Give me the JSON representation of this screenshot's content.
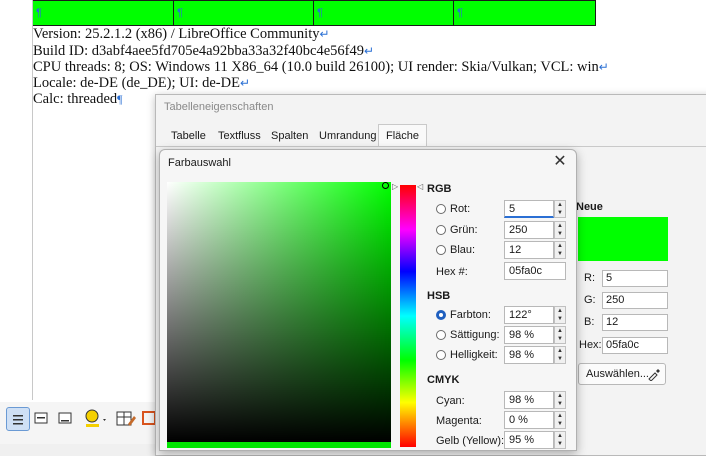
{
  "document": {
    "pilcrow": "¶",
    "line_break": "↵",
    "lines": {
      "version": "Version: 25.2.1.2 (x86) / LibreOffice Community",
      "build": "Build ID: d3abf4aee5fd705e4a92bba33a32f40bc4e56f49",
      "cpu": "CPU threads: 8; OS: Windows 11 X86_64 (10.0 build 26100); UI render: Skia/Vulkan; VCL: win",
      "locale": "Locale: de-DE (de_DE); UI: de-DE",
      "calc": "Calc: threaded"
    },
    "table_color": "#00ff00"
  },
  "table_dialog": {
    "title": "Tabelleneigenschaften",
    "tabs": [
      "Tabelle",
      "Textfluss",
      "Spalten",
      "Umrandung",
      "Fläche"
    ],
    "active_tab": "Fläche",
    "new_label": "Neue",
    "new_color": "#00ff00",
    "r_label": "R:",
    "r_value": "5",
    "g_label": "G:",
    "g_value": "250",
    "b_label": "B:",
    "b_value": "12",
    "hex_label": "Hex:",
    "hex_value": "05fa0c",
    "pick_button": "Auswählen..."
  },
  "color_dialog": {
    "title": "Farbauswahl",
    "rgb": {
      "heading": "RGB",
      "red_label": "Rot:",
      "red_value": "5",
      "green_label": "Grün:",
      "green_value": "250",
      "blue_label": "Blau:",
      "blue_value": "12",
      "hex_label": "Hex #:",
      "hex_value": "05fa0c"
    },
    "hsb": {
      "heading": "HSB",
      "hue_label": "Farbton:",
      "hue_value": "122°",
      "sat_label": "Sättigung:",
      "sat_value": "98 %",
      "bright_label": "Helligkeit:",
      "bright_value": "98 %"
    },
    "cmyk": {
      "heading": "CMYK",
      "cyan_label": "Cyan:",
      "cyan_value": "98 %",
      "magenta_label": "Magenta:",
      "magenta_value": "0 %",
      "yellow_label": "Gelb (Yellow):",
      "yellow_value": "95 %"
    },
    "selected_mode": "Farbton",
    "current_color": "#05fa0c"
  },
  "icons": {
    "close": "close-icon",
    "eyedropper": "eyedropper-icon"
  }
}
